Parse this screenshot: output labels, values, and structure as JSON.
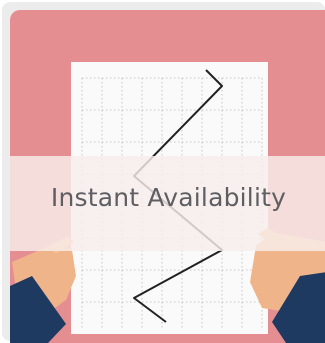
{
  "card": {
    "caption": "Instant Availability",
    "illustration": "hands-holding-graph-paper-with-zigzag-line-icon"
  },
  "colors": {
    "background": "#e58e92",
    "paper": "#fafafa",
    "skin": "#f0b48a",
    "sleeve": "#1f3a60",
    "text": "#5e5e63"
  }
}
